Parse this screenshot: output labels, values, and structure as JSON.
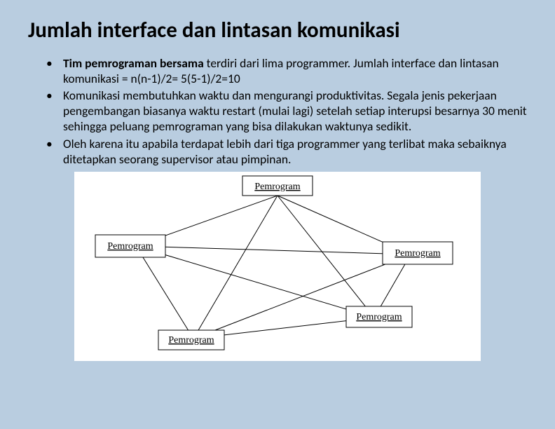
{
  "title": "Jumlah interface dan lintasan komunikasi",
  "bullets": {
    "b1_bold": "Tim pemrograman bersama",
    "b1_rest": " terdiri dari lima programmer. Jumlah interface dan lintasan komunikasi = n(n-1)/2= 5(5-1)/2=10",
    "b2": "Komunikasi membutuhkan waktu dan mengurangi produktivitas. Segala jenis pekerjaan pengembangan biasanya waktu restart (mulai lagi) setelah setiap interupsi besarnya 30 menit sehingga peluang pemrograman yang bisa dilakukan waktunya sedikit.",
    "b3": "Oleh karena itu apabila terdapat lebih dari tiga programmer yang terlibat maka sebaiknya ditetapkan seorang supervisor atau pimpinan."
  },
  "diagram": {
    "nodes": {
      "n1": "Pemrogram",
      "n2": "Pemrogram",
      "n3": "Pemrogram",
      "n4": "Pemrogram",
      "n5": "Pemrogram"
    }
  }
}
